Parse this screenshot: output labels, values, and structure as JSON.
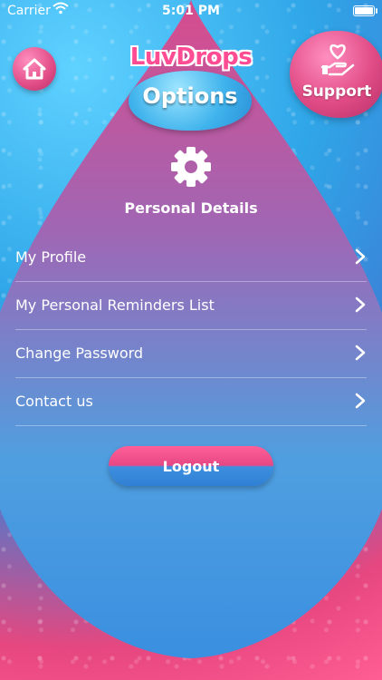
{
  "status_bar": {
    "carrier": "Carrier",
    "time": "5:01 PM"
  },
  "header": {
    "brand": "LuvDrops",
    "title": "Options",
    "support_label": "Support"
  },
  "section": {
    "title": "Personal Details"
  },
  "menu": {
    "items": [
      {
        "label": "My Profile"
      },
      {
        "label": "My Personal Reminders List"
      },
      {
        "label": "Change Password"
      },
      {
        "label": "Contact us"
      }
    ]
  },
  "logout_label": "Logout",
  "colors": {
    "pink": "#e7477f",
    "blue": "#3c8be0",
    "accent_pink": "#ff4c93"
  },
  "icons": [
    "home-icon",
    "heart-hand-icon",
    "gear-icon",
    "chevron-right-icon",
    "wifi-icon",
    "battery-icon"
  ]
}
